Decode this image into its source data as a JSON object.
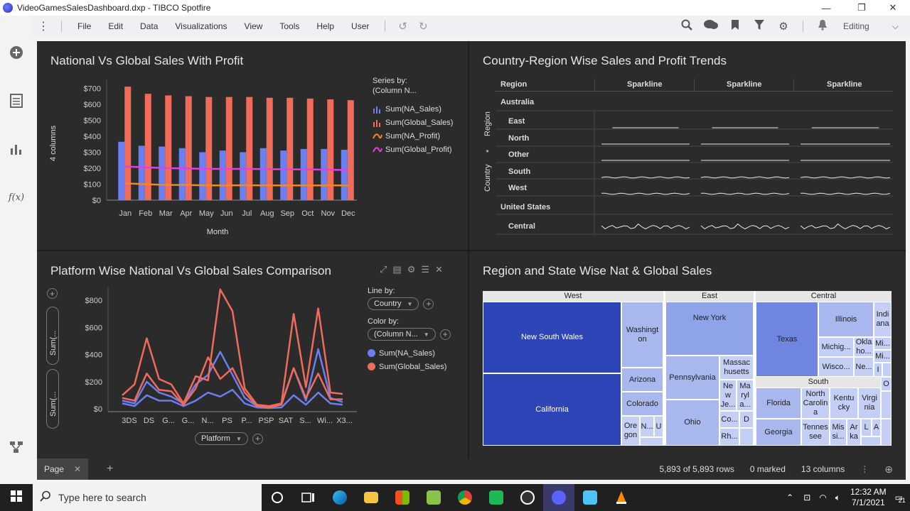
{
  "window": {
    "title": "VideoGamesSalesDashboard.dxp - TIBCO Spotfire",
    "minimize": "—",
    "restore": "❐",
    "close": "✕"
  },
  "menu": {
    "items": [
      "File",
      "Edit",
      "Data",
      "Visualizations",
      "View",
      "Tools",
      "Help",
      "User"
    ],
    "mode": "Editing"
  },
  "panel1": {
    "title": "National Vs Global Sales With Profit",
    "chart_data": {
      "type": "bar",
      "categories": [
        "Jan",
        "Feb",
        "Mar",
        "Apr",
        "May",
        "Jun",
        "Jul",
        "Aug",
        "Sep",
        "Oct",
        "Nov",
        "Dec"
      ],
      "series": [
        {
          "name": "Sum(NA_Sales)",
          "kind": "bar",
          "color": "#6b7ff0",
          "values": [
            365,
            340,
            335,
            325,
            300,
            310,
            300,
            325,
            310,
            320,
            320,
            315
          ]
        },
        {
          "name": "Sum(Global_Sales)",
          "kind": "bar",
          "color": "#f06b5a",
          "values": [
            710,
            665,
            655,
            650,
            645,
            645,
            645,
            640,
            640,
            635,
            630,
            625
          ]
        },
        {
          "name": "Sum(NA_Profit)",
          "kind": "line",
          "color": "#f0882b",
          "values": [
            105,
            100,
            95,
            95,
            92,
            92,
            93,
            92,
            92,
            92,
            92,
            92
          ]
        },
        {
          "name": "Sum(Global_Profit)",
          "kind": "line",
          "color": "#e040e0",
          "values": [
            210,
            205,
            200,
            198,
            196,
            195,
            195,
            194,
            193,
            192,
            190,
            188
          ]
        }
      ],
      "yticks": [
        "$0",
        "$100",
        "$200",
        "$300",
        "$400",
        "$500",
        "$600",
        "$700"
      ],
      "ylim": [
        0,
        750
      ],
      "xlabel": "Month",
      "ylabel": "4 columns",
      "legend_title": "Series by:",
      "legend_subtitle": "(Column N...",
      "legend_position": "right"
    }
  },
  "panel2": {
    "title": "Country-Region Wise Sales and Profit Trends",
    "header_region": "Region",
    "columns": [
      "Sparkline",
      "Sparkline",
      "Sparkline"
    ],
    "side_labels": [
      "Region",
      "*",
      "Country"
    ],
    "groups": [
      {
        "country": "Australia",
        "rows": [
          "East",
          "North",
          "Other",
          "South",
          "West"
        ]
      },
      {
        "country": "United States",
        "rows": [
          "Central"
        ]
      }
    ]
  },
  "panel3": {
    "title": "Platform Wise National Vs Global Sales Comparison",
    "chart_data": {
      "type": "line",
      "categories": [
        "3DS",
        "DS",
        "G...",
        "G...",
        "N...",
        "PS",
        "P...",
        "PSP",
        "SAT",
        "S...",
        "Wi...",
        "X3..."
      ],
      "yticks": [
        "$0",
        "$200",
        "$400",
        "$600",
        "$800"
      ],
      "ylim": [
        0,
        900
      ],
      "series": [
        {
          "name": "Sum(NA_Sales)",
          "color": "#6b7ff0",
          "values": [
            60,
            40,
            200,
            120,
            90,
            40,
            180,
            250,
            420,
            250,
            80,
            20,
            10,
            40,
            300,
            60,
            440,
            80,
            50
          ]
        },
        {
          "name": "Sum(NA_Sales)",
          "color": "#6b7ff0",
          "values": [
            40,
            20,
            100,
            60,
            60,
            20,
            60,
            120,
            90,
            140,
            40,
            10,
            5,
            10,
            100,
            30,
            120,
            40,
            30
          ]
        },
        {
          "name": "Sum(Global_Sales)",
          "color": "#f06b5a",
          "values": [
            100,
            180,
            520,
            220,
            180,
            40,
            240,
            210,
            880,
            720,
            150,
            30,
            20,
            40,
            700,
            160,
            740,
            120,
            110
          ]
        },
        {
          "name": "Sum(Global_Sales)",
          "color": "#f06b5a",
          "values": [
            80,
            60,
            260,
            140,
            130,
            30,
            150,
            380,
            220,
            300,
            120,
            20,
            10,
            30,
            300,
            80,
            260,
            70,
            70
          ]
        }
      ],
      "xlabel": "Platform",
      "ylabel_pills": [
        "Sum(...",
        "Sum(..."
      ],
      "line_by_label": "Line by:",
      "line_by_value": "Country",
      "color_by_label": "Color by:",
      "color_by_value": "(Column N...",
      "legend": [
        "Sum(NA_Sales)",
        "Sum(Global_Sales)"
      ]
    }
  },
  "panel4": {
    "title": "Region and State Wise Nat & Global Sales",
    "regions": [
      "West",
      "East",
      "Central",
      "South"
    ],
    "tiles": {
      "nsw": "New South Wales",
      "california": "California",
      "washington": "Washingt on",
      "arizona": "Arizona",
      "colorado": "Colorado",
      "oregon": "Ore gon",
      "n": "N...",
      "u": "U",
      "newyork": "New York",
      "pennsylvania": "Pennsylvania",
      "ohio": "Ohio",
      "massachusetts": "Massac husetts",
      "newjersey": "Ne w Je...",
      "maryland": "Ma ryl a...",
      "co": "Co...",
      "d": "D",
      "rh": "Rh...",
      "texas": "Texas",
      "illinois": "Illinois",
      "indiana": "Indi ana",
      "michigan": "Michig...",
      "oklahoma": "Okla ho...",
      "mi1": "Mi...",
      "mi2": "Mi...",
      "wisconsin": "Wisco...",
      "ne": "Ne...",
      "i": "I",
      "florida": "Florida",
      "northcarolina": "North Carolin a",
      "kentucky": "Kentu cky",
      "virginia": "Virgi nia",
      "o": "O",
      "georgia": "Georgia",
      "tennessee": "Tennes see",
      "mis": "Mis si...",
      "ark": "Ar ka",
      "l": "L",
      "a": "A"
    }
  },
  "status": {
    "tab": "Page",
    "rows": "5,893 of 5,893 rows",
    "marked": "0 marked",
    "columns": "13 columns"
  },
  "taskbar": {
    "search_placeholder": "Type here to search",
    "time": "12:32 AM",
    "date": "7/1/2021",
    "notif_count": "21"
  }
}
